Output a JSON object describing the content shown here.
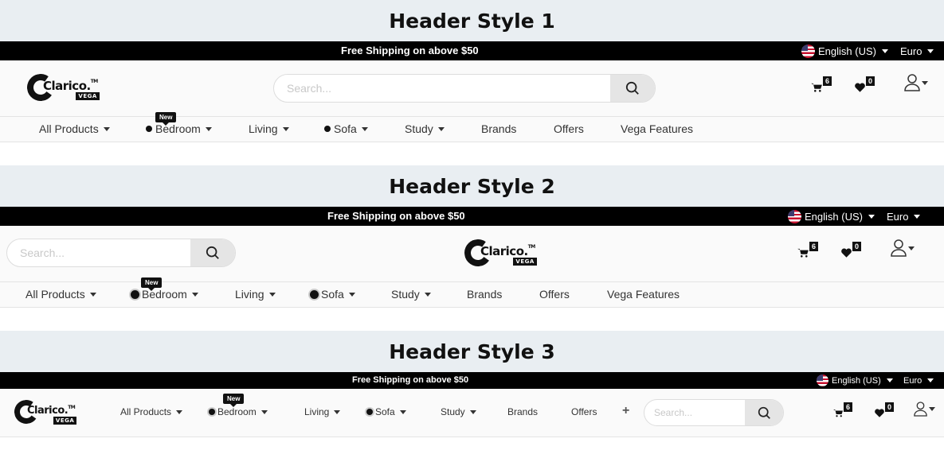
{
  "styles": [
    {
      "title": "Header Style 1",
      "shipping": "Free Shipping on above $50",
      "language": "English (US)",
      "currency": "Euro",
      "logo": {
        "name": "Clarico.",
        "tm": "TM",
        "sub": "VEGA"
      },
      "search_placeholder": "Search...",
      "cart_count": "6",
      "wishlist_count": "0",
      "new_tag": "New",
      "nav": [
        "All Products",
        "Bedroom",
        "Living",
        "Sofa",
        "Study",
        "Brands",
        "Offers",
        "Vega Features"
      ]
    },
    {
      "title": "Header Style 2",
      "shipping": "Free Shipping on above $50",
      "language": "English (US)",
      "currency": "Euro",
      "logo": {
        "name": "Clarico.",
        "tm": "TM",
        "sub": "VEGA"
      },
      "search_placeholder": "Search...",
      "cart_count": "6",
      "wishlist_count": "0",
      "new_tag": "New",
      "nav": [
        "All Products",
        "Bedroom",
        "Living",
        "Sofa",
        "Study",
        "Brands",
        "Offers",
        "Vega Features"
      ]
    },
    {
      "title": "Header Style 3",
      "shipping": "Free Shipping on above $50",
      "language": "English (US)",
      "currency": "Euro",
      "logo": {
        "name": "Clarico.",
        "tm": "TM",
        "sub": "VEGA"
      },
      "search_placeholder": "Search...",
      "cart_count": "6",
      "wishlist_count": "0",
      "new_tag": "New",
      "nav": [
        "All Products",
        "Bedroom",
        "Living",
        "Sofa",
        "Study",
        "Brands",
        "Offers"
      ],
      "more_symbol": "+"
    }
  ],
  "icons": {
    "search": "search-icon",
    "cart": "cart-icon",
    "wishlist": "heart-icon",
    "account": "user-icon",
    "flag": "us-flag-icon"
  },
  "colors": {
    "topbar": "#000000",
    "title_band": "#e9eef2",
    "header_bg": "#fafafa",
    "accent": "#111111"
  }
}
